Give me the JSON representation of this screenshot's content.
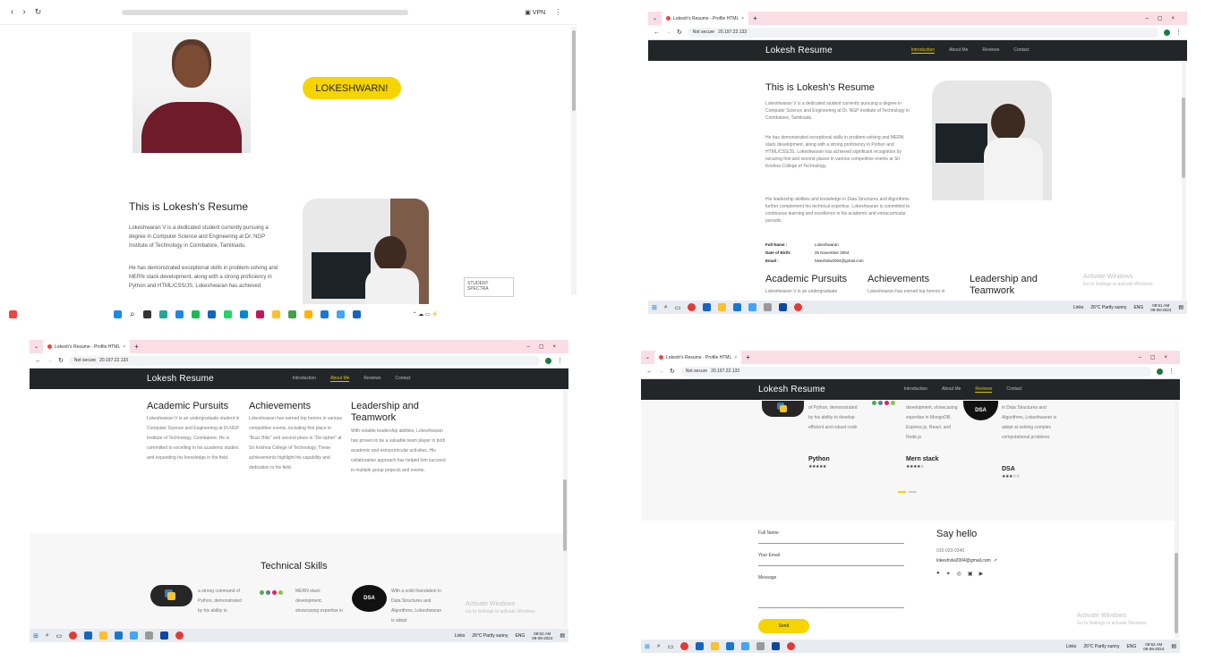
{
  "phone_top": {
    "badge_text": "LOKESHWARN!",
    "page_title": "This is Lokesh's Resume",
    "para1": "Lokeshwaran V is a dedicated student currently pursuing a degree in Computer Science and Engineering at Dr. NGP Institute of Technology in Coimbatore, Tamilnadu.",
    "para2": "He has demonstrated exceptional skills in problem-solving and MERN stack development, along with a strong proficiency in Python and HTML/CSS/JS. Lokeshwaran has achieved",
    "toast": "STUDENT SPECTRA"
  },
  "browser": {
    "tab_title": "Lokesh's Resume - Profile HTML",
    "not_secure": "Not secure",
    "url": "20.197.22.133"
  },
  "site": {
    "brand": "Lokesh Resume",
    "nav": [
      "Introduction",
      "About Me",
      "Reviews",
      "Contact"
    ]
  },
  "intro": {
    "title": "This is Lokesh's Resume",
    "p1": "Lokeshwaran V is a dedicated student currently pursuing a degree in Computer Science and Engineering at Dr. NGP Institute of Technology in Coimbatore, Tamilnadu.",
    "p2": "He has demonstrated exceptional skills in problem-solving and MERN stack development, along with a strong proficiency in Python and HTML/CSS/JS. Lokeshwaran has achieved significant recognition by securing first and second places in various competitive events at Sri Krishna College of Technology.",
    "p3": "His leadership abilities and knowledge in Data Structures and Algorithms further complement his technical expertise. Lokeshwaran is committed to continuous learning and excellence in his academic and extracurricular pursuits.",
    "facts": [
      {
        "label": "Full Name :",
        "value": "Lokeshwaran"
      },
      {
        "label": "Date of Birth:",
        "value": "25 November 2004"
      },
      {
        "label": "Email :",
        "value": "lokeshvlw2004@gmail.com"
      }
    ],
    "strip_headings": [
      "Academic Pursuits",
      "Achievements",
      "Leadership and Teamwork"
    ],
    "strip_snippets": [
      "Lokeshwaran V is an undergraduate",
      "Lokeshwaran has earned top honors in"
    ]
  },
  "about": {
    "cards": [
      {
        "title": "Academic Pursuits",
        "text": "Lokeshwaran V is an undergraduate student in Computer Science and Engineering at Dr.NGP Institute of Technology, Coimbatore. He is committed to excelling in his academic studies and expanding his knowledge in the field."
      },
      {
        "title": "Achievements",
        "text": "Lokeshwaran has earned top honors in various competitive events, including first place in \"Buzz Blitz\" and second place in \"De-cipher\" at Sri Krishna College of Technology. These achievements highlight his capability and dedication to his field."
      },
      {
        "title": "Leadership and Teamwork",
        "text": "With notable leadership abilities, Lokeshwaran has proven to be a valuable team player in both academic and extracurricular activities. His collaborative approach has helped him succeed in multiple group projects and events."
      }
    ],
    "skills_heading": "Technical Skills",
    "skill_snippets": [
      "a strong command of Python, demonstrated by his ability to",
      "MERN stack development, showcasing expertise in",
      "With a solid foundation in Data Structures and Algorithms, Lokeshwaran is adept"
    ]
  },
  "reviews": {
    "skills": [
      {
        "text": "of Python, demonstrated by his ability to develop efficient and robust code",
        "name": "Python",
        "rating": 5
      },
      {
        "text": "development, showcasing expertise in MongoDB, Express.js, React, and Node.js",
        "name": "Mern stack",
        "rating": 4
      },
      {
        "text": "in Data Structures and Algorithms, Lokeshwaran is adept at solving complex computational problems.",
        "name": "DSA",
        "rating": 3
      }
    ],
    "form": {
      "full_name": "Full Name",
      "email": "Your Email",
      "message": "Message",
      "send": "Send"
    },
    "say_hello": "Say hello",
    "phone": "010-020-0340",
    "email": "lokeshvlw2004@gmail.com"
  },
  "taskbar": {
    "links": "Links",
    "weather": "26°C  Partly sunny",
    "lang": "ENG",
    "time1": "09:51 AM",
    "time2": "09:52 AM",
    "date": "09-08-2024"
  },
  "activate": {
    "title": "Activate Windows",
    "sub": "Go to Settings to activate Windows."
  },
  "colors": {
    "accent": "#f5d400",
    "nav_bg": "#222629",
    "tab_bg": "#fbdde6"
  }
}
